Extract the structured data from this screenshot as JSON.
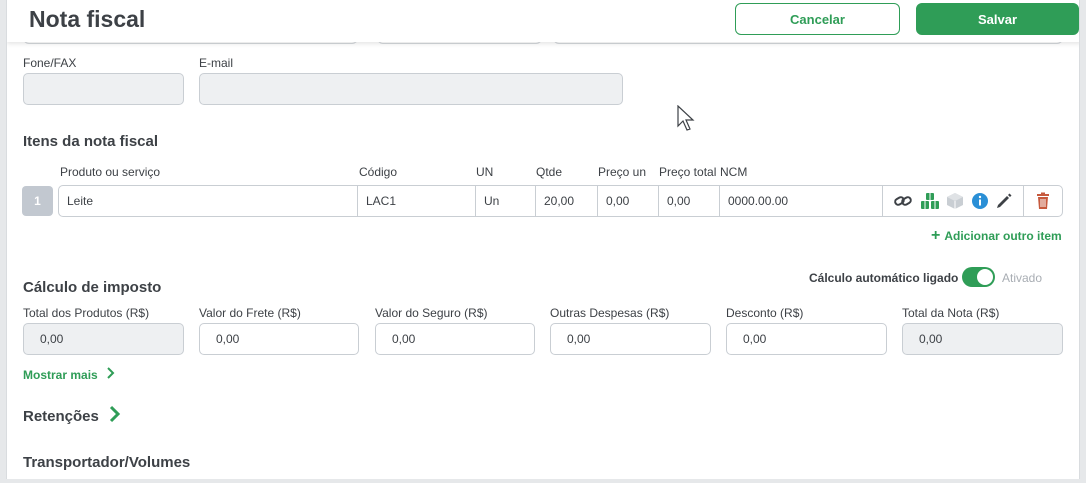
{
  "header": {
    "title": "Nota fiscal",
    "cancel_label": "Cancelar",
    "save_label": "Salvar"
  },
  "contact": {
    "phone_label": "Fone/FAX",
    "phone_value": "",
    "email_label": "E-mail",
    "email_value": ""
  },
  "items": {
    "section_title": "Itens da nota fiscal",
    "columns": [
      "Produto ou serviço",
      "Código",
      "UN",
      "Qtde",
      "Preço un",
      "Preço total",
      "NCM"
    ],
    "rows": [
      {
        "index": "1",
        "product": "Leite",
        "code": "LAC1",
        "unit": "Un",
        "qty": "20,00",
        "unit_price": "0,00",
        "total_price": "0,00",
        "ncm": "0000.00.00"
      }
    ],
    "add_label": "Adicionar outro item"
  },
  "tax": {
    "section_title": "Cálculo de imposto",
    "auto_label": "Cálculo automático ligado",
    "auto_state": "Ativado",
    "fields": [
      {
        "label": "Total dos Produtos (R$)",
        "value": "0,00"
      },
      {
        "label": "Valor do Frete (R$)",
        "value": "0,00"
      },
      {
        "label": "Valor do Seguro (R$)",
        "value": "0,00"
      },
      {
        "label": "Outras Despesas (R$)",
        "value": "0,00"
      },
      {
        "label": "Desconto (R$)",
        "value": "0,00"
      },
      {
        "label": "Total da Nota (R$)",
        "value": "0,00"
      }
    ],
    "show_more_label": "Mostrar mais"
  },
  "retentions": {
    "title": "Retenções"
  },
  "carrier": {
    "title": "Transportador/Volumes"
  },
  "colors": {
    "accent": "#2f9d57",
    "delete": "#c65a3e",
    "info": "#2a8fd6"
  },
  "icons": [
    "link-icon",
    "stock-boxes-icon",
    "package-icon",
    "info-icon",
    "edit-pencil-icon",
    "trash-icon",
    "plus-icon",
    "chevron-right-icon",
    "cursor-icon"
  ]
}
